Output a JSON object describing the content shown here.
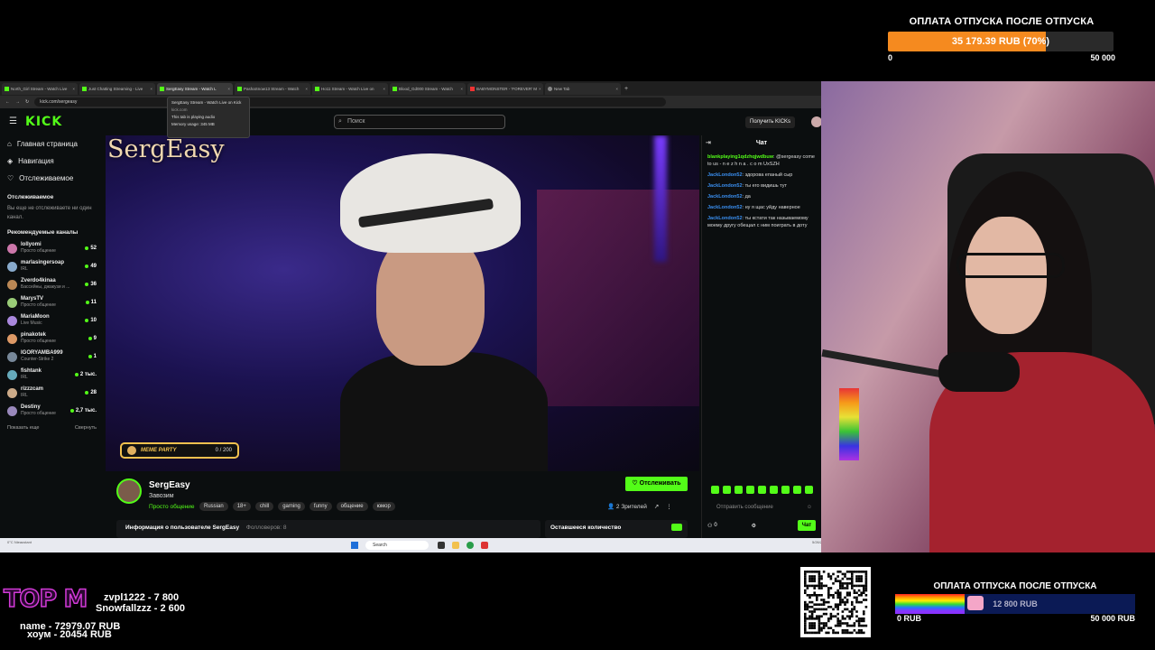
{
  "goal_top": {
    "title": "ОПЛАТА ОТПУСКА ПОСЛЕ ОТПУСКА",
    "progress_text": "35 179.39 RUB (70%)",
    "progress_fraction": 0.7,
    "min": "0",
    "max": "50 000",
    "fill_color": "#f58a1f"
  },
  "browser": {
    "tabs": [
      {
        "label": "North_Girl Stream - Watch Live"
      },
      {
        "label": "Just Chatting Streaming - Live"
      },
      {
        "label": "SergEasy Stream - Watch L"
      },
      {
        "label": "PashaSnow13 Stream - Watch"
      },
      {
        "label": "Ho11 Stream - Watch Live on"
      },
      {
        "label": "Blood_Gd000 Stream - Watch"
      },
      {
        "label": "BABYMONSTER - 'FOREVER' M"
      },
      {
        "label": "New Tab"
      }
    ],
    "url": "kick.com/sergeasy",
    "tooltip": {
      "title": "SergEasy Stream - Watch Live on Kick",
      "domain": "kick.com",
      "audio": "This tab is playing audio",
      "memory": "Memory usage: 345 MB"
    }
  },
  "kick": {
    "logo": "KICK",
    "search_placeholder": "Поиск",
    "kicks_button": "Получить KICKs",
    "accent": "#53fc18"
  },
  "sidebar": {
    "nav": [
      {
        "label": "Главная страница",
        "icon": "home-icon"
      },
      {
        "label": "Навигация",
        "icon": "compass-icon"
      },
      {
        "label": "Отслеживаемое",
        "icon": "heart-icon"
      }
    ],
    "following_title": "Отслеживаемое",
    "following_empty": "Вы еще не отслеживаете ни один канал.",
    "recommended_title": "Рекомендуемые каналы",
    "channels": [
      {
        "name": "lollyomi",
        "category": "Просто общение",
        "viewers": "52"
      },
      {
        "name": "marlasingersoap",
        "category": "IRL",
        "viewers": "49"
      },
      {
        "name": "Zverdo4kinaa",
        "category": "Бассейны, джакузи и ...",
        "viewers": "36"
      },
      {
        "name": "MarysTV",
        "category": "Просто общение",
        "viewers": "11"
      },
      {
        "name": "MariaMoon",
        "category": "Live Music",
        "viewers": "10"
      },
      {
        "name": "pinakotek",
        "category": "Просто общение",
        "viewers": "9"
      },
      {
        "name": "IGORYAMBA999",
        "category": "Counter-Strike 2",
        "viewers": "1"
      },
      {
        "name": "fishtank",
        "category": "IRL",
        "viewers": "2 тыс."
      },
      {
        "name": "rizzzcam",
        "category": "IRL",
        "viewers": "28"
      },
      {
        "name": "Destiny",
        "category": "Просто общение",
        "viewers": "2,7 тыс."
      }
    ],
    "show_more": "Показать еще",
    "collapse": "Свернуть"
  },
  "video": {
    "watermark": "SergEasy",
    "meme_label": "MEME PARTY",
    "meme_value": "0 / 200"
  },
  "chat": {
    "title": "Чат",
    "messages": [
      {
        "user": "blankplaying1qdzhqjwdbuw",
        "text": ": @sergeasy come to us - n e z h n a . c o m UxSZH",
        "color": "#53fc18"
      },
      {
        "user": "JackLondon52",
        "text": ": здорова епаный сыр",
        "color": "#3a8ff0"
      },
      {
        "user": "JackLondon52",
        "text": ": ты его видишь тут",
        "color": "#3a8ff0"
      },
      {
        "user": "JackLondon52",
        "text": ": да",
        "color": "#3a8ff0"
      },
      {
        "user": "JackLondon52",
        "text": ": ну я щас уйду наверное",
        "color": "#3a8ff0"
      },
      {
        "user": "JackLondon52",
        "text": ": ты кстати так называемому моему другу обещал с ним поиграть в доту",
        "color": "#3a8ff0"
      }
    ],
    "input_placeholder": "Отправить сообщение",
    "kicks_count": "0",
    "send_label": "Чат"
  },
  "channel": {
    "name": "SergEasy",
    "title": "Завозим",
    "category": "Просто общение",
    "tags": [
      "Russian",
      "18+",
      "chill",
      "gaming",
      "funny",
      "общение",
      "юмор"
    ],
    "follow_label": "Отслеживать",
    "viewers": "2 Зрителей",
    "about": "Информация о пользователе SergEasy",
    "followers": "Фолловеров: 8",
    "remaining": "Оставшееся количество"
  },
  "taskbar": {
    "weather": "0°C Nieaustant",
    "search": "Search",
    "tray": "5/26/2025"
  },
  "overlay": {
    "top_label": "TOP M",
    "donors": [
      "zvpl1222 - 7 800",
      "Snowfallzzz - 2 600",
      "name - 72979.07 RUB",
      "хоум - 20454 RUB"
    ]
  },
  "goal_bottom": {
    "title": "ОПЛАТА ОТПУСКА ПОСЛЕ ОТПУСКА",
    "progress_text": "12 800 RUB",
    "progress_fraction": 0.29,
    "min": "0 RUB",
    "max": "50 000 RUB"
  }
}
